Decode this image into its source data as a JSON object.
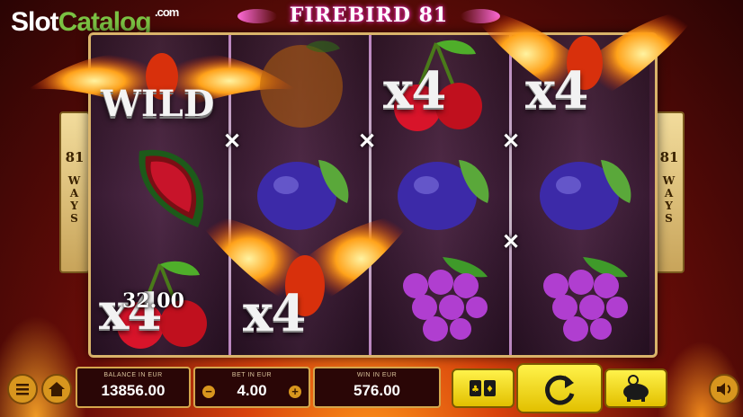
{
  "watermark": {
    "part1": "Slot",
    "part2": "Catalog",
    "domain": ".com"
  },
  "game_title": "FIREBIRD 81",
  "ways": {
    "number": "81",
    "word_letters": [
      "W",
      "A",
      "Y",
      "S"
    ]
  },
  "symbols": {
    "reel1": [
      "wild",
      "watermelon",
      "cherries"
    ],
    "reel2": [
      "orange",
      "plum",
      "phoenix"
    ],
    "reel3": [
      "cherries",
      "plum",
      "grapes"
    ],
    "reel4": [
      "phoenix",
      "plum",
      "grapes"
    ]
  },
  "overlays": {
    "wild_label": "WILD",
    "multiplier_label": "x4",
    "win_amount_on_reel": "32.00"
  },
  "hud": {
    "balance_label": "BALANCE IN EUR",
    "balance_value": "13856.00",
    "bet_label": "BET IN EUR",
    "bet_value": "4.00",
    "bet_minus": "−",
    "bet_plus": "+",
    "win_label": "WIN IN EUR",
    "win_value": "576.00"
  },
  "icons": [
    "menu-icon",
    "home-icon",
    "cards-icon",
    "spin-icon",
    "piggy-bank-icon",
    "sound-icon"
  ],
  "colors": {
    "accent": "#f0d000",
    "frame": "#d9b36a",
    "panel_bg": "#2a0606"
  }
}
